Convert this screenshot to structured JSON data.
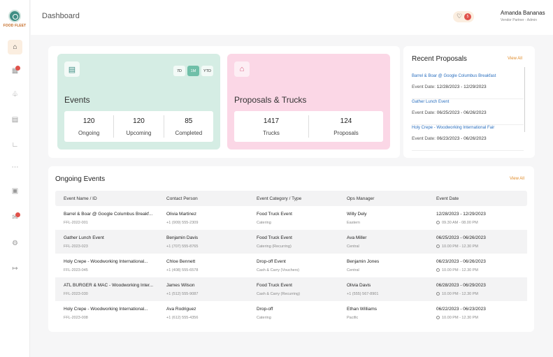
{
  "brand": {
    "logo_text": "FOOD FLEET",
    "accent": "#e08c2a",
    "primary": "#3f8e84"
  },
  "sidebar": {
    "items": [
      {
        "name": "home",
        "icon": "home-icon",
        "active": true
      },
      {
        "name": "calendar",
        "icon": "calendar-icon",
        "badge": true
      },
      {
        "name": "trophy",
        "icon": "trophy-icon"
      },
      {
        "name": "documents",
        "icon": "document-icon"
      },
      {
        "name": "tools",
        "icon": "chart-icon"
      },
      {
        "name": "users",
        "icon": "users-icon"
      },
      {
        "name": "gallery",
        "icon": "image-icon"
      },
      {
        "name": "messages",
        "icon": "chat-icon",
        "badge": true
      },
      {
        "name": "settings",
        "icon": "gear-icon"
      },
      {
        "name": "logout",
        "icon": "logout-icon"
      }
    ]
  },
  "header": {
    "title": "Dashboard",
    "notifications_count": "5",
    "user_name": "Amanda Bananas",
    "user_role": "Vendor Partner - Admin"
  },
  "events_card": {
    "title": "Events",
    "ranges": [
      "7D",
      "1M",
      "YTD"
    ],
    "active_range": "1M",
    "stats": [
      {
        "value": "120",
        "label": "Ongoing"
      },
      {
        "value": "120",
        "label": "Upcoming"
      },
      {
        "value": "85",
        "label": "Completed"
      }
    ]
  },
  "proposals_card": {
    "title": "Proposals & Trucks",
    "stats": [
      {
        "value": "1417",
        "label": "Trucks"
      },
      {
        "value": "124",
        "label": "Proposals"
      }
    ]
  },
  "recent_proposals": {
    "title": "Recent Proposals",
    "view_all": "View All",
    "date_label": "Event Date:",
    "items": [
      {
        "name": "Barrel & Boar @ Google Columbus Breakfast",
        "dates": "12/28/2023 - 12/29/2023"
      },
      {
        "name": "Gather Lunch Event",
        "dates": "06/25/2023 - 06/26/2023"
      },
      {
        "name": "Holy Crepe - Woodworking International Fair",
        "dates": "06/23/2023 - 06/26/2023"
      }
    ]
  },
  "ongoing_events": {
    "title": "Ongoing Events",
    "view_all": "View All",
    "columns": [
      "Event Name / ID",
      "Contact Person",
      "Event Category / Type",
      "Ops Manager",
      "Event Date"
    ],
    "rows": [
      {
        "name": "Barrel & Boar @ Google Columbus Breakf...",
        "id": "FFL-2022-001",
        "contact": "Olivia Martinez",
        "phone": "+1 (909) 555-2309",
        "category": "Food Truck Event",
        "type": "Catering",
        "manager": "Willy Dely",
        "region": "Eastern",
        "dates": "12/28/2023 - 12/29/2023",
        "time": "09.30 AM - 08.00 PM"
      },
      {
        "name": "Gather Lunch Event",
        "id": "FFL-2023-023",
        "contact": "Benjamin Davis",
        "phone": "+1 (707) 555-8765",
        "category": "Food Truck Event",
        "type": "Catering (Recurring)",
        "manager": "Ava Miller",
        "region": "Central",
        "dates": "06/25/2023 - 06/26/2023",
        "time": "10.00 PM - 12.30 PM"
      },
      {
        "name": "Holy Crepe - Woodworking International...",
        "id": "FFL-2023-045",
        "contact": "Chloe Bennett",
        "phone": "+1 (408) 555-6578",
        "category": "Drop-off Event",
        "type": "Cash & Carry (Vouchers)",
        "manager": "Benjamin Jones",
        "region": "Central",
        "dates": "06/23/2023 - 06/26/2023",
        "time": "10.00 PM - 12.30 PM"
      },
      {
        "name": "ATL BURGER & MAC - Woodworking Inter...",
        "id": "FFL-2023-030",
        "contact": "James Wilson",
        "phone": "+1 (512) 555-9087",
        "category": "Food Truck Event",
        "type": "Cash & Carry (Recurring)",
        "manager": "Olivia Davis",
        "region": "+1 (555) 567-8901",
        "dates": "06/28/2023 - 06/29/2023",
        "time": "10.00 PM - 12.30 PM"
      },
      {
        "name": "Holy Crepe - Woodworking International...",
        "id": "FFL-2023-008",
        "contact": "Ava Rodriguez",
        "phone": "+1 (612) 555-4356",
        "category": "Drop-off",
        "type": "Catering",
        "manager": "Ethan Williams",
        "region": "Pacific",
        "dates": "06/22/2023 - 06/23/2023",
        "time": "10.00 PM - 12.30 PM"
      }
    ]
  }
}
